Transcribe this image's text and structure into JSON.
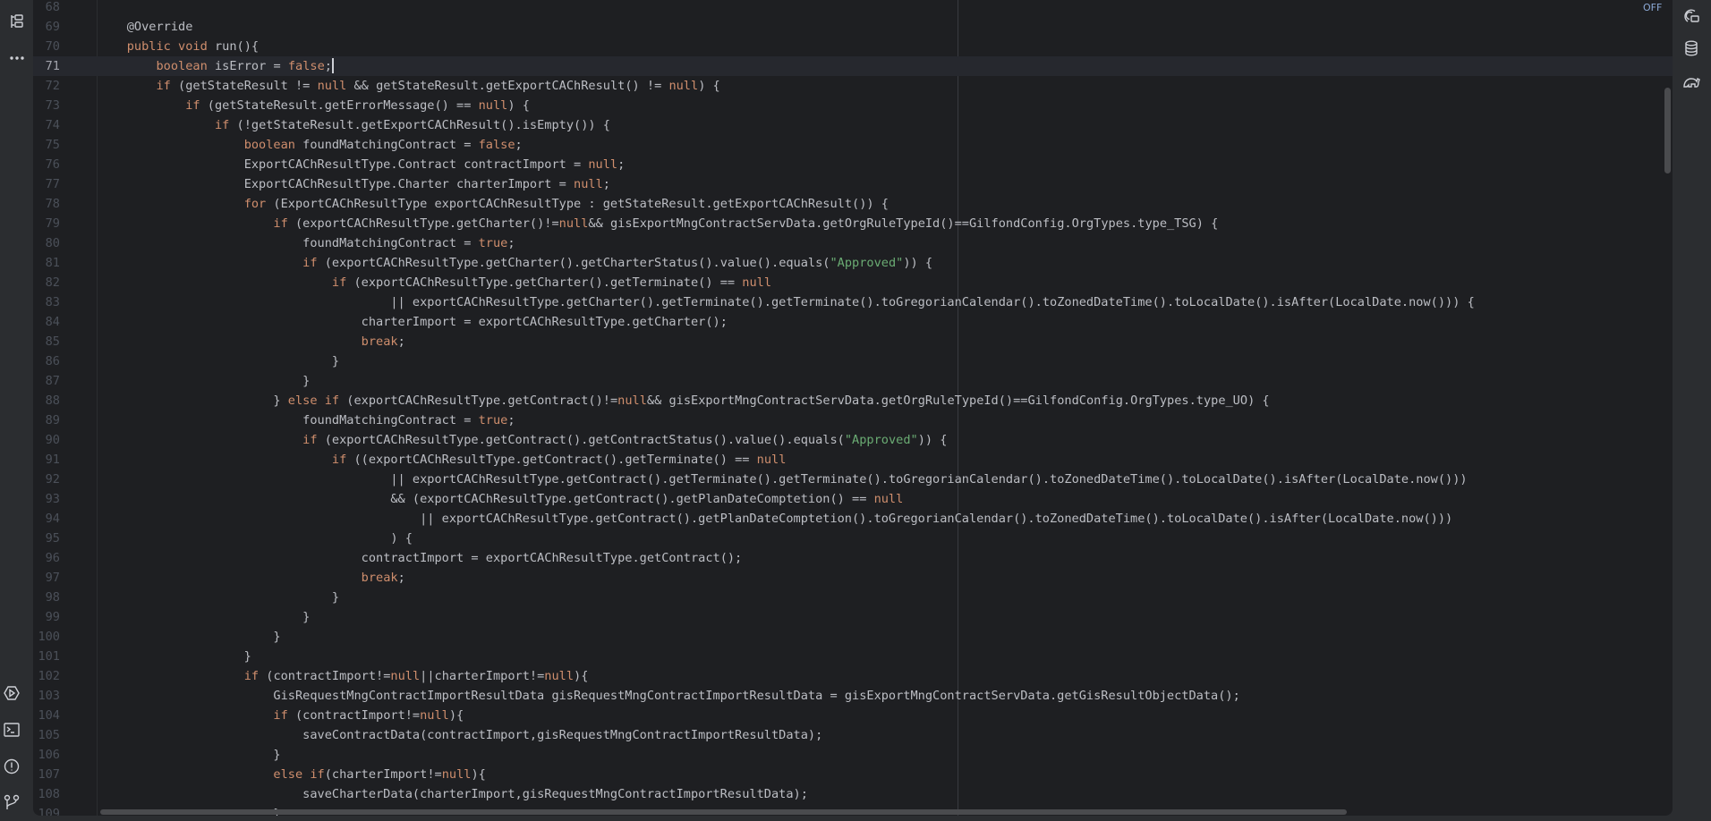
{
  "left_sidebar": {
    "top_icons": [
      "structure-icon",
      "more-icon"
    ],
    "bottom_icons": [
      "run-icon",
      "terminal-icon",
      "problems-icon",
      "git-icon"
    ]
  },
  "right_sidebar": {
    "icons": [
      "ai-assistant-icon",
      "database-icon",
      "gradle-icon"
    ]
  },
  "editor": {
    "inspection_status": "OFF",
    "current_line": 71,
    "first_line": 68,
    "colors": {
      "keyword": "#CF8E6D",
      "string": "#6AAB73",
      "text": "#BCBEC4",
      "background": "#1E1F22"
    },
    "lines": [
      "",
      "    @Override",
      "    public void run(){",
      "        boolean isError = false;",
      "        if (getStateResult != null && getStateResult.getExportCAChResult() != null) {",
      "            if (getStateResult.getErrorMessage() == null) {",
      "                if (!getStateResult.getExportCAChResult().isEmpty()) {",
      "                    boolean foundMatchingContract = false;",
      "                    ExportCAChResultType.Contract contractImport = null;",
      "                    ExportCAChResultType.Charter charterImport = null;",
      "                    for (ExportCAChResultType exportCAChResultType : getStateResult.getExportCAChResult()) {",
      "                        if (exportCAChResultType.getCharter()!=null&& gisExportMngContractServData.getOrgRuleTypeId()==GilfondConfig.OrgTypes.type_TSG) {",
      "                            foundMatchingContract = true;",
      "                            if (exportCAChResultType.getCharter().getCharterStatus().value().equals(\"Approved\")) {",
      "                                if (exportCAChResultType.getCharter().getTerminate() == null",
      "                                        || exportCAChResultType.getCharter().getTerminate().getTerminate().toGregorianCalendar().toZonedDateTime().toLocalDate().isAfter(LocalDate.now())) {",
      "                                    charterImport = exportCAChResultType.getCharter();",
      "                                    break;",
      "                                }",
      "                            }",
      "                        } else if (exportCAChResultType.getContract()!=null&& gisExportMngContractServData.getOrgRuleTypeId()==GilfondConfig.OrgTypes.type_UO) {",
      "                            foundMatchingContract = true;",
      "                            if (exportCAChResultType.getContract().getContractStatus().value().equals(\"Approved\")) {",
      "                                if ((exportCAChResultType.getContract().getTerminate() == null",
      "                                        || exportCAChResultType.getContract().getTerminate().getTerminate().toGregorianCalendar().toZonedDateTime().toLocalDate().isAfter(LocalDate.now()))",
      "                                        && (exportCAChResultType.getContract().getPlanDateComptetion() == null",
      "                                            || exportCAChResultType.getContract().getPlanDateComptetion().toGregorianCalendar().toZonedDateTime().toLocalDate().isAfter(LocalDate.now()))",
      "                                        ) {",
      "                                    contractImport = exportCAChResultType.getContract();",
      "                                    break;",
      "                                }",
      "                            }",
      "                        }",
      "                    }",
      "                    if (contractImport!=null||charterImport!=null){",
      "                        GisRequestMngContractImportResultData gisRequestMngContractImportResultData = gisExportMngContractServData.getGisResultObjectData();",
      "                        if (contractImport!=null){",
      "                            saveContractData(contractImport,gisRequestMngContractImportResultData);",
      "                        }",
      "                        else if(charterImport!=null){",
      "                            saveCharterData(charterImport,gisRequestMngContractImportResultData);",
      "                        }"
    ]
  }
}
